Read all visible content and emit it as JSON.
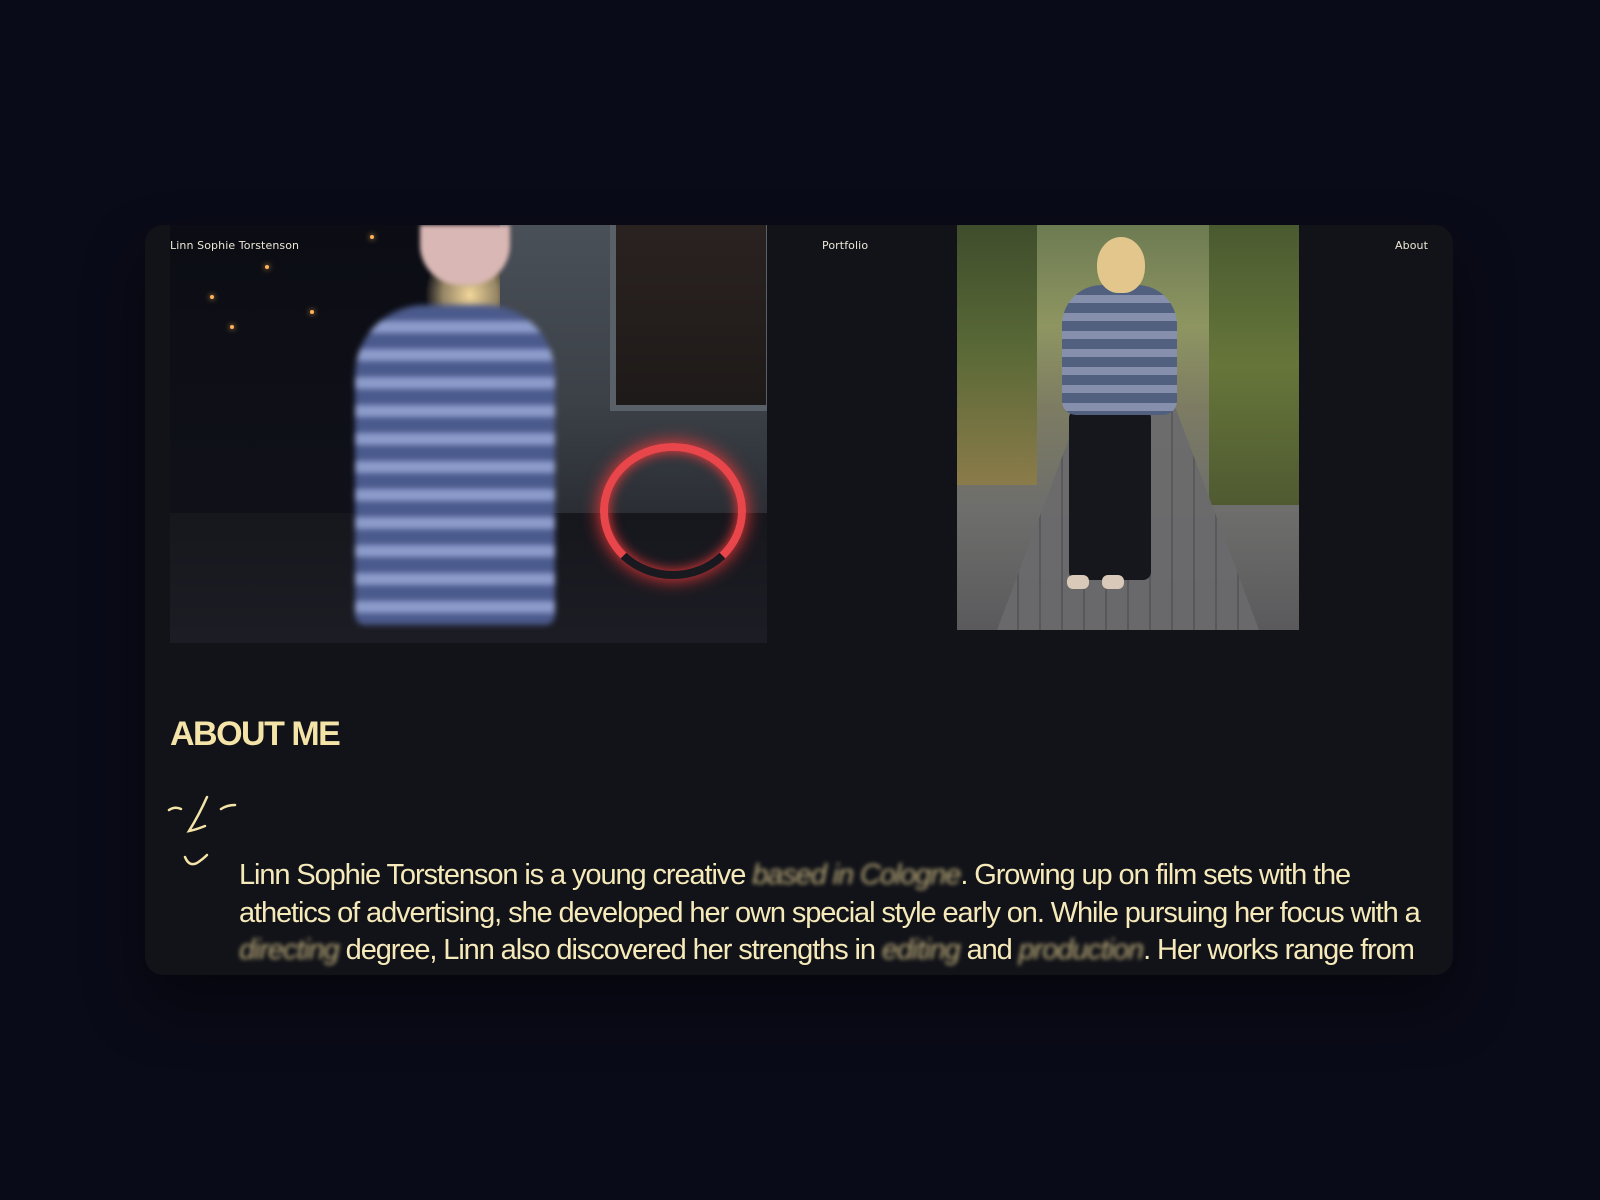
{
  "header": {
    "brand": "Linn Sophie Torstenson",
    "nav": [
      {
        "label": "Portfolio"
      },
      {
        "label": "About"
      }
    ]
  },
  "about": {
    "heading": "ABOUT ME",
    "bio": {
      "s1": "Linn Sophie Torstenson is a young creative ",
      "h1": "based in Cologne",
      "s2": ". Growing up on film sets with the athetics of advertising, she developed her own special style early on. While pursuing her focus with a ",
      "h2": "directing",
      "s3": " degree, Linn also discovered her strengths in ",
      "h3": "editing",
      "s4": " and ",
      "h4": "production",
      "s5": ". Her works range from fashion brands, cosmetic to music videos and so on. Her focus always"
    }
  },
  "colors": {
    "page_background": "#0a0b18",
    "card_background": "#121319",
    "heading_color": "#f4e4a8",
    "text_color": "#f6eaba",
    "nav_text_color": "#ece7d6"
  }
}
